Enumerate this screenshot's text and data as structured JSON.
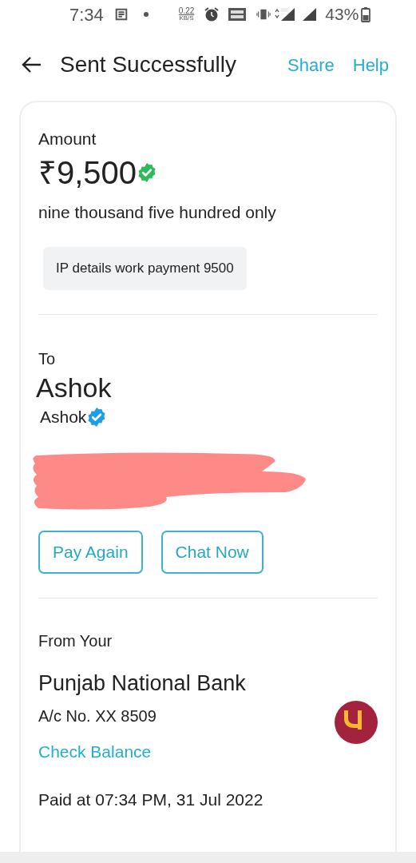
{
  "status_bar": {
    "time": "7:34",
    "data_speed": "0.22",
    "data_unit": "KB/S",
    "battery": "43%"
  },
  "header": {
    "title": "Sent Successfully",
    "actions": [
      "Share",
      "Help"
    ]
  },
  "amount": {
    "label": "Amount",
    "value": "₹9,500",
    "verified": true,
    "words": "nine thousand five hundred only",
    "note": "IP details work payment 9500"
  },
  "recipient": {
    "label": "To",
    "name": "Ashok",
    "sub_name": "Ashok",
    "verified": true,
    "buttons": [
      "Pay Again",
      "Chat Now"
    ]
  },
  "source": {
    "label": "From Your",
    "bank": "Punjab National Bank",
    "account": "A/c No. XX 8509",
    "link": "Check Balance",
    "paid_at": "Paid at 07:34 PM, 31 Jul 2022"
  }
}
